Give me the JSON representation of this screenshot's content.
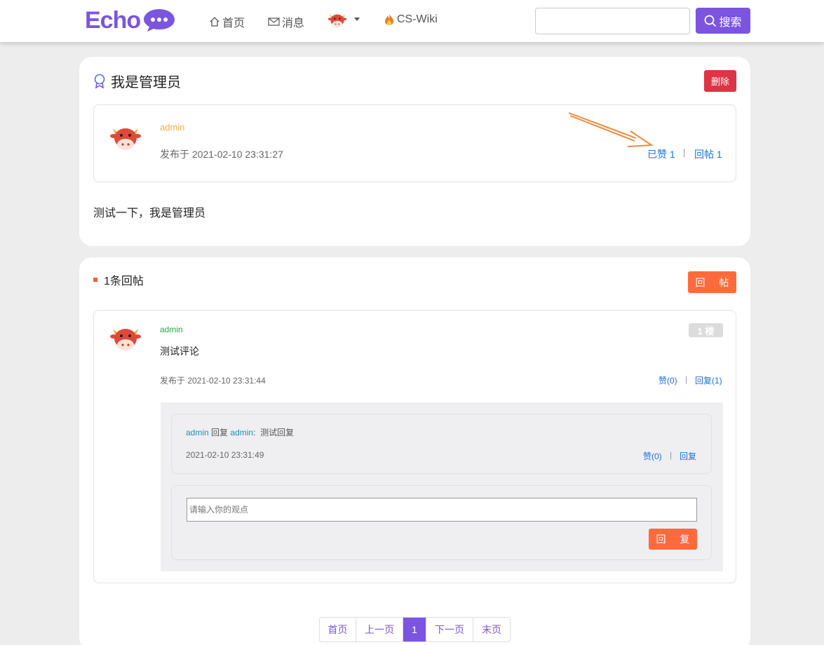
{
  "header": {
    "logo_text": "Echo",
    "nav_home": "首页",
    "nav_messages": "消息",
    "nav_wiki": "CS-Wiki",
    "search_value": "",
    "search_button": "搜索"
  },
  "post": {
    "title": "我是管理员",
    "delete_button": "删除",
    "author": "admin",
    "published": "发布于 2021-02-10 23:31:27",
    "liked_label": "已赞 1",
    "reply_count_label": "回帖 1",
    "separator": "|",
    "content": "测试一下，我是管理员"
  },
  "replies": {
    "count_label": "1条回帖",
    "reply_button": "回 帖",
    "items": [
      {
        "author": "admin",
        "floor": "1 楼",
        "content": "测试评论",
        "published": "发布于 2021-02-10 23:31:44",
        "like_label": "赞(0)",
        "reply_label": "回复(1)",
        "sub_replies": [
          {
            "author": "admin",
            "reply_word": "回复",
            "target": "admin",
            "colon": ":",
            "content": "测试回复",
            "time": "2021-02-10 23:31:49",
            "like_label": "赞(0)",
            "reply_label": "回复"
          }
        ],
        "form_placeholder": "请输入你的观点",
        "form_submit": "回 复"
      }
    ]
  },
  "pagination": {
    "first": "首页",
    "prev": "上一页",
    "current": "1",
    "next": "下一页",
    "last": "末页"
  },
  "colors": {
    "brand": "#7b55e0",
    "delete": "#dc3545",
    "reply": "#ff6a3d",
    "link": "#1a73e8",
    "author_gold": "#f0ad4e",
    "author_green": "#28a745"
  }
}
